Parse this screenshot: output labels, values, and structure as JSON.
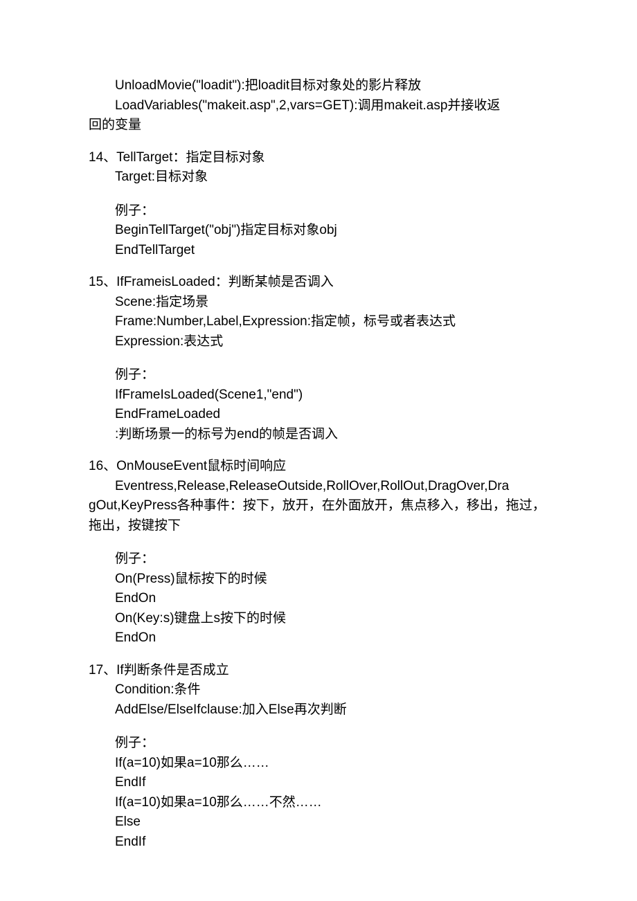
{
  "lines": {
    "l01": "UnloadMovie(\"loadit\"):把loadit目标对象处的影片释放",
    "l02": "LoadVariables(\"makeit.asp\",2,vars=GET):调用makeit.asp并接收返",
    "l02b": "回的变量",
    "s14_title": "14、TellTarget：指定目标对象",
    "s14_01": "Target:目标对象",
    "s14_ex": "例子：",
    "s14_02": "BeginTellTarget(\"obj\")指定目标对象obj",
    "s14_03": " EndTellTarget",
    "s15_title": "15、IfFrameisLoaded：判断某帧是否调入",
    "s15_01": "Scene:指定场景",
    "s15_02": " Frame:Number,Label,Expression:指定帧，标号或者表达式",
    "s15_03": "Expression:表达式",
    "s15_ex": "例子：",
    "s15_04": "IfFrameIsLoaded(Scene1,\"end\")",
    "s15_05": " EndFrameLoaded",
    "s15_06": ":判断场景一的标号为end的帧是否调入",
    "s16_title": "16、OnMouseEvent鼠标时间响应",
    "s16_01": "Eventress,Release,ReleaseOutside,RollOver,RollOut,DragOver,Dra",
    "s16_01b": "gOut,KeyPress各种事件：按下，放开，在外面放开，焦点移入，移出，拖过，",
    "s16_01c": "拖出，按键按下",
    "s16_ex": "例子：",
    "s16_02": "On(Press)鼠标按下的时候",
    "s16_03": "EndOn",
    "s16_04": " On(Key:s)键盘上s按下的时候",
    "s16_05": "EndOn",
    "s17_title": "17、If判断条件是否成立",
    "s17_01": "Condition:条件",
    "s17_02": "AddElse/ElseIfclause:加入Else再次判断",
    "s17_ex": "例子：",
    "s17_03": "If(a=10)如果a=10那么……",
    "s17_04": "EndIf",
    "s17_05": " If(a=10)如果a=10那么……不然……",
    "s17_06": "Else",
    "s17_07": "EndIf"
  }
}
